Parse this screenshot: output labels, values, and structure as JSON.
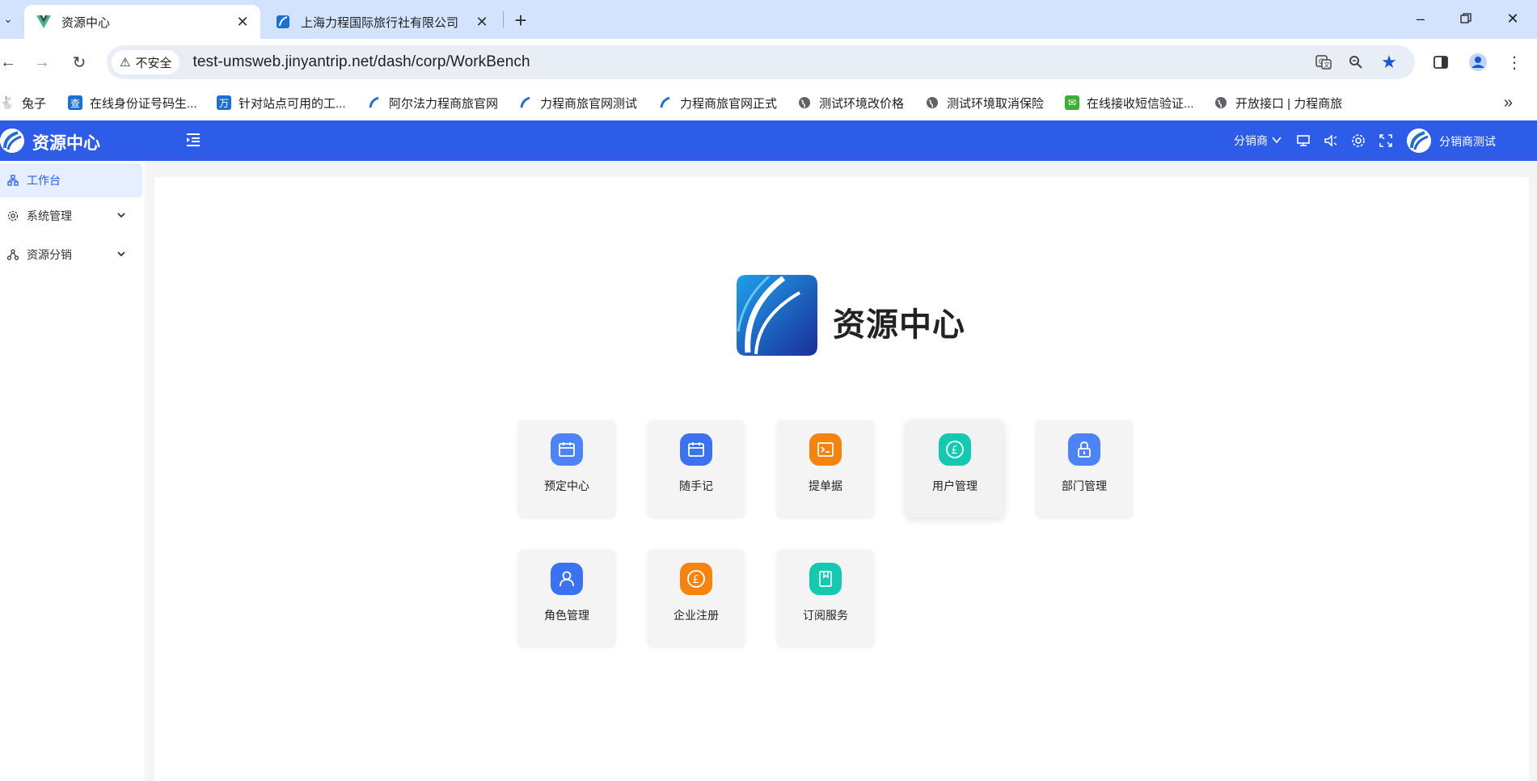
{
  "browser": {
    "tabs": [
      {
        "title": "资源中心",
        "active": true
      },
      {
        "title": "上海力程国际旅行社有限公司",
        "active": false
      }
    ],
    "security_label": "不安全",
    "url": "test-umsweb.jinyantrip.net/dash/corp/WorkBench",
    "bookmarks": [
      {
        "label": "兔子",
        "icon": "rabbit-icon"
      },
      {
        "label": "在线身份证号码生...",
        "icon": "cha-icon",
        "glyph": "查"
      },
      {
        "label": "针对站点可用的工...",
        "icon": "wan-icon",
        "glyph": "万"
      },
      {
        "label": "阿尔法力程商旅官网",
        "icon": "licheng-logo-icon"
      },
      {
        "label": "力程商旅官网测试",
        "icon": "licheng-logo-icon"
      },
      {
        "label": "力程商旅官网正式",
        "icon": "licheng-logo-icon"
      },
      {
        "label": "测试环境改价格",
        "icon": "globe-icon"
      },
      {
        "label": "测试环境取消保险",
        "icon": "globe-icon"
      },
      {
        "label": "在线接收短信验证...",
        "icon": "chat-icon"
      },
      {
        "label": "开放接口 | 力程商旅",
        "icon": "globe-icon"
      }
    ],
    "colors": {
      "tabstrip": "#d3e3fd",
      "omnibox": "#e9eef6",
      "star": "#1a57d6"
    }
  },
  "app": {
    "title": "资源中心",
    "role_dropdown": "分销商",
    "user_name": "分销商测试",
    "colors": {
      "header": "#2c5ce8",
      "active_menu_bg": "#e6efff",
      "active_menu_text": "#2c5ce8"
    }
  },
  "sidebar": {
    "items": [
      {
        "label": "工作台",
        "icon": "workbench-icon",
        "active": true
      },
      {
        "label": "系统管理",
        "icon": "gear-icon",
        "expandable": true
      },
      {
        "label": "资源分销",
        "icon": "share-icon",
        "expandable": true
      }
    ]
  },
  "main": {
    "hero_title": "资源中心",
    "tiles": [
      {
        "label": "预定中心",
        "icon": "calendar-icon",
        "color": "#4c83f7"
      },
      {
        "label": "随手记",
        "icon": "calendar-icon",
        "color": "#3b72f0"
      },
      {
        "label": "提单据",
        "icon": "terminal-icon",
        "color": "#f5840f"
      },
      {
        "label": "用户管理",
        "icon": "pound-coin-icon",
        "color": "#14c9b0"
      },
      {
        "label": "部门管理",
        "icon": "lock-icon",
        "color": "#4c83f7"
      },
      {
        "label": "角色管理",
        "icon": "user-icon",
        "color": "#3b72f0"
      },
      {
        "label": "企业注册",
        "icon": "pound-coin-icon",
        "color": "#f5840f"
      },
      {
        "label": "订阅服务",
        "icon": "book-icon",
        "color": "#14c9b0"
      }
    ]
  }
}
